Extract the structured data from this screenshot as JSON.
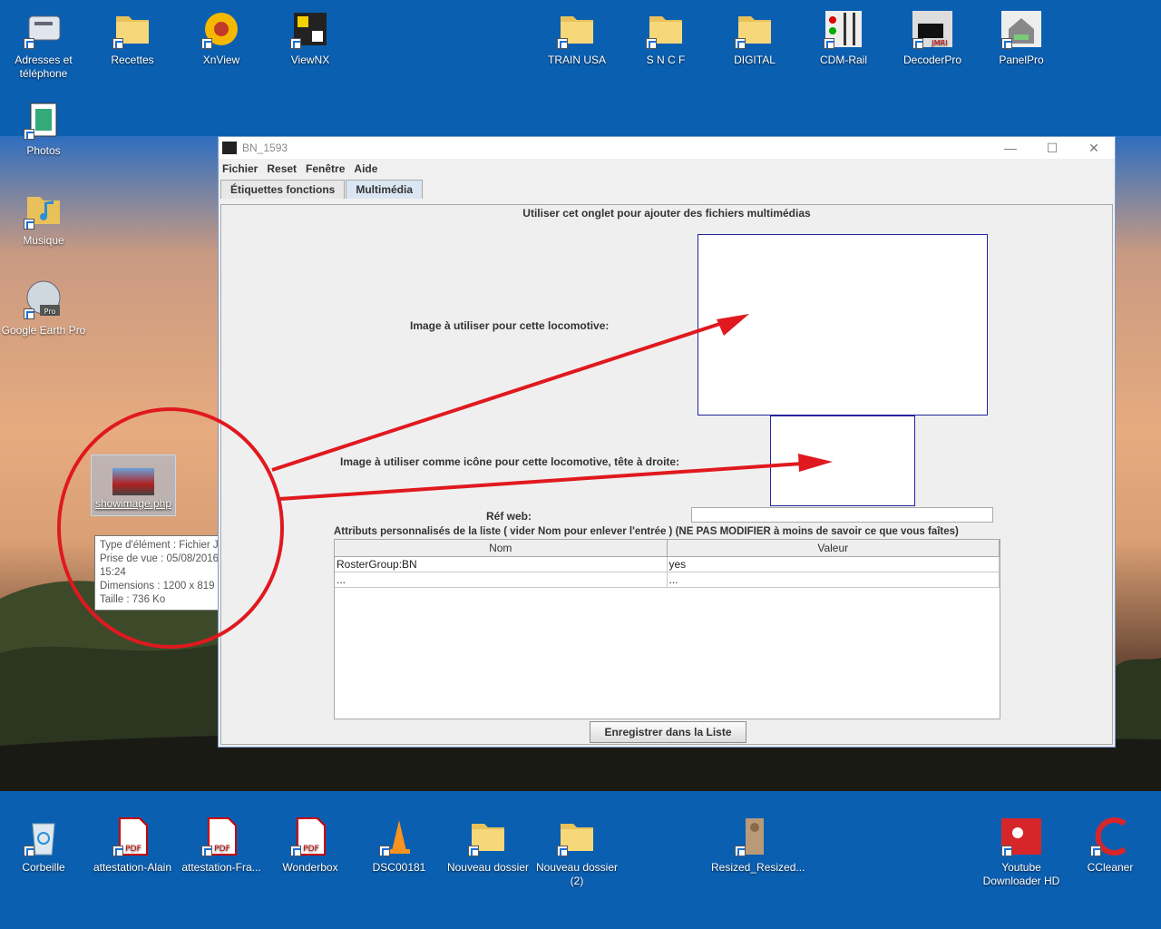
{
  "desktop_top_icons": [
    {
      "label": "Adresses et téléphone",
      "icon": "address-book-icon"
    },
    {
      "label": "Recettes",
      "icon": "folder-icon"
    },
    {
      "label": "XnView",
      "icon": "xnview-icon"
    },
    {
      "label": "ViewNX",
      "icon": "viewnx-icon"
    },
    {
      "label": "TRAIN USA",
      "icon": "folder-icon"
    },
    {
      "label": "S N C F",
      "icon": "folder-icon"
    },
    {
      "label": "DIGITAL",
      "icon": "folder-icon"
    },
    {
      "label": "CDM-Rail",
      "icon": "cdm-rail-icon"
    },
    {
      "label": "DecoderPro",
      "icon": "decoderpro-icon"
    },
    {
      "label": "PanelPro",
      "icon": "panelpro-icon"
    }
  ],
  "desktop_left_icons": [
    {
      "label": "Photos",
      "icon": "film-icon"
    },
    {
      "label": "Musique",
      "icon": "music-folder-icon"
    },
    {
      "label": "Google Earth Pro",
      "icon": "google-earth-icon"
    }
  ],
  "desktop_bottom_icons": [
    {
      "label": "Corbeille",
      "icon": "recycle-bin-icon"
    },
    {
      "label": "attestation-Alain",
      "icon": "pdf-icon"
    },
    {
      "label": "attestation-Fra...",
      "icon": "pdf-icon"
    },
    {
      "label": "Wonderbox",
      "icon": "pdf-icon"
    },
    {
      "label": "DSC00181",
      "icon": "vlc-icon"
    },
    {
      "label": "Nouveau dossier",
      "icon": "folder-icon"
    },
    {
      "label": "Nouveau dossier (2)",
      "icon": "folder-icon"
    },
    {
      "label": "Resized_Resized...",
      "icon": "image-icon"
    },
    {
      "label": "Youtube Downloader HD",
      "icon": "youtube-downloader-icon"
    },
    {
      "label": "CCleaner",
      "icon": "ccleaner-icon"
    }
  ],
  "dragged_file": {
    "label": "showimage.php"
  },
  "tooltip": {
    "type": "Type d'élément : Fichier JPG",
    "date": "Prise de vue : 05/08/2016 15:24",
    "dims": "Dimensions : 1200 x 819",
    "size": "Taille : 736 Ko"
  },
  "window": {
    "title": "BN_1593",
    "menus": [
      "Fichier",
      "Reset",
      "Fenêtre",
      "Aide"
    ],
    "tabs": [
      {
        "label": "Étiquettes fonctions",
        "active": false
      },
      {
        "label": "Multimédia",
        "active": true
      }
    ],
    "panel": {
      "heading": "Utiliser cet onglet pour ajouter des fichiers multimédias",
      "image_label": "Image à utiliser pour cette locomotive:",
      "icon_label": "Image à utiliser comme icône pour cette locomotive, tête à droite:",
      "web_label": "Réf web:",
      "web_value": "",
      "attrs_label": "Attributs personnalisés de la liste ( vider Nom pour enlever l'entrée ) (NE PAS MODIFIER à moins de savoir ce que vous faîtes)",
      "columns": [
        "Nom",
        "Valeur"
      ],
      "rows": [
        [
          "RosterGroup:BN",
          "yes"
        ],
        [
          "...",
          "..."
        ]
      ],
      "save_label": "Enregistrer dans la Liste"
    }
  },
  "colors": {
    "desktop_blue": "#0b5fb1",
    "annotation_red": "#e0191f",
    "image_box_border": "#23239b"
  }
}
